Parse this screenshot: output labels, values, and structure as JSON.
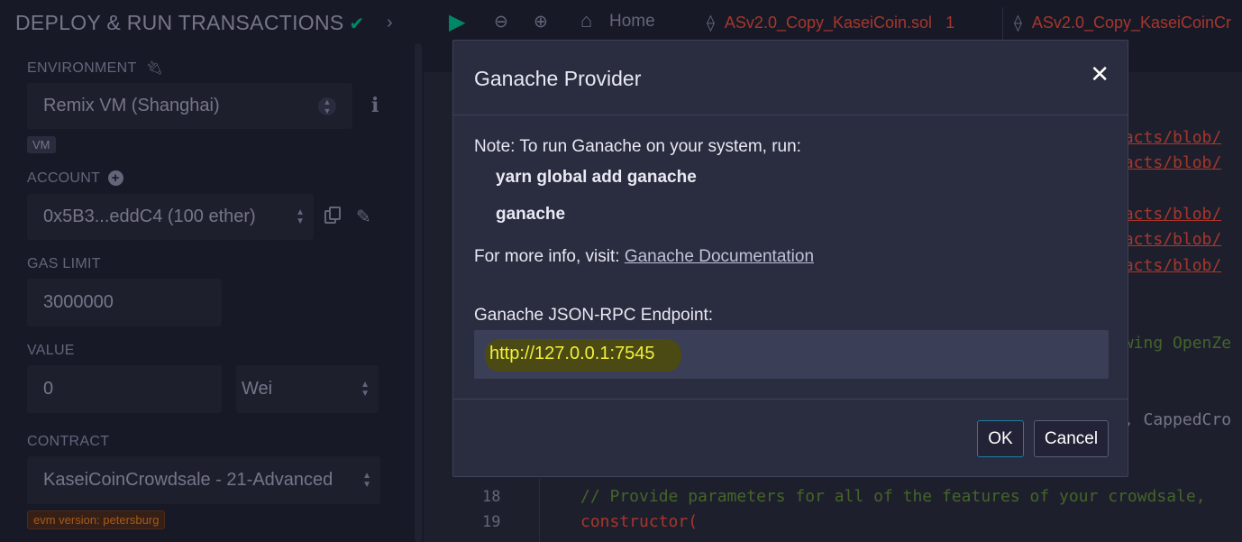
{
  "panel": {
    "title": "DEPLOY & RUN TRANSACTIONS",
    "environment_label": "ENVIRONMENT",
    "environment_value": "Remix VM (Shanghai)",
    "vm_badge": "VM",
    "account_label": "ACCOUNT",
    "account_value": "0x5B3...eddC4 (100 ether)",
    "gas_limit_label": "GAS LIMIT",
    "gas_limit_value": "3000000",
    "value_label": "VALUE",
    "value_amount": "0",
    "value_unit": "Wei",
    "contract_label": "CONTRACT",
    "contract_value": "KaseiCoinCrowdsale - 21-Advanced",
    "evm_badge": "evm version: petersburg"
  },
  "editor": {
    "home_label": "Home",
    "tab1_label": "ASv2.0_Copy_KaseiCoin.sol",
    "tab1_count": "1",
    "tab2_label": "ASv2.0_Copy_KaseiCoinCr",
    "link_fragment": "racts/blob/",
    "comment_fragment": "owing OpenZe",
    "inherit_fragment": "e, CappedCro",
    "line18_no": "18",
    "line18_code": "// Provide parameters for all of the features of your crowdsale,",
    "line19_no": "19",
    "line19_code": "constructor("
  },
  "modal": {
    "title": "Ganache Provider",
    "note": "Note: To run Ganache on your system, run:",
    "cmd1": "yarn global add ganache",
    "cmd2": "ganache",
    "info_prefix": "For more info, visit:",
    "info_link": "Ganache Documentation",
    "endpoint_label": "Ganache JSON-RPC Endpoint:",
    "endpoint_value": "http://127.0.0.1:7545",
    "ok_label": "OK",
    "cancel_label": "Cancel"
  }
}
